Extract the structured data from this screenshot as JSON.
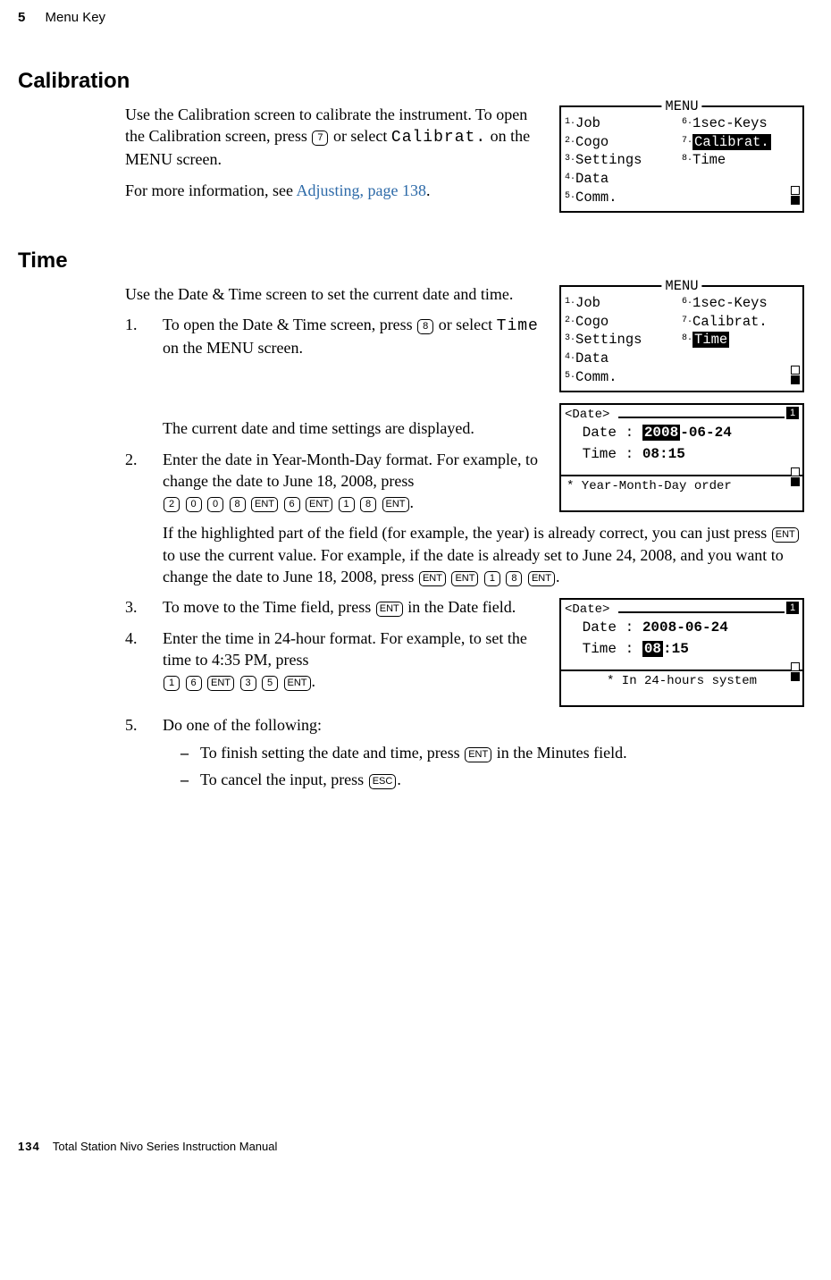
{
  "header": {
    "chapter": "5",
    "title": "Menu Key"
  },
  "calibration": {
    "heading": "Calibration",
    "p1a": "Use the Calibration screen to calibrate the instrument. To open the Calibration screen, press ",
    "p1_key": "7",
    "p1b": " or select ",
    "p1_mono": "Calibrat.",
    "p1c": " on the MENU screen.",
    "p2a": "For more information, see ",
    "p2_link": "Adjusting, page 138",
    "p2b": "."
  },
  "time": {
    "heading": "Time",
    "p1": "Use the Date & Time screen to set the current date and time.",
    "s1a": "To open the Date & Time screen, press ",
    "s1_key": "8",
    "s1b": " or select ",
    "s1_mono": "Time",
    "s1c": " on the MENU screen.",
    "s1d": "The current date and time settings are displayed.",
    "s2a": "Enter the date in Year-Month-Day format. For example, to change the date to June 18, 2008, press",
    "s2_keys": [
      "2",
      "0",
      "0",
      "8",
      "ENT",
      "6",
      "ENT",
      "1",
      "8",
      "ENT"
    ],
    "s2b": ".",
    "s2c_a": "If the highlighted part of the field (for example, the year) is already correct, you can just press ",
    "s2c_key": "ENT",
    "s2c_b": " to use the current value. For example, if the date is already set to June 24, 2008, and you want to change the date to June 18, 2008, press ",
    "s2c_keys": [
      "ENT",
      "ENT",
      "1",
      "8",
      "ENT"
    ],
    "s2c_c": ".",
    "s3a": "To move to the Time field, press ",
    "s3_key": "ENT",
    "s3b": " in the Date field.",
    "s4a": "Enter the time in 24-hour format. For example, to set the time to 4:35 PM, press",
    "s4_keys": [
      "1",
      "6",
      "ENT",
      "3",
      "5",
      "ENT"
    ],
    "s4b": ".",
    "s5": "Do one of the following:",
    "s5a_a": "To finish setting the date and time, press ",
    "s5a_key": "ENT",
    "s5a_b": " in the Minutes field.",
    "s5b_a": "To cancel the input, press ",
    "s5b_key": "ESC",
    "s5b_b": "."
  },
  "menu_screen": {
    "title": "MENU",
    "left": [
      "Job",
      "Cogo",
      "Settings",
      "Data",
      "Comm."
    ],
    "right": [
      "1sec-Keys",
      "Calibrat.",
      "Time"
    ]
  },
  "date_screen1": {
    "title": "<Date>",
    "corner": "1",
    "date_label": "Date",
    "date_val_hl": "2008",
    "date_val_rest": "-06-24",
    "time_label": "Time",
    "time_val": "08:15",
    "foot": "* Year-Month-Day order"
  },
  "date_screen2": {
    "title": "<Date>",
    "corner": "1",
    "date_label": "Date",
    "date_val": "2008-06-24",
    "time_label": "Time",
    "time_val_hl": "08",
    "time_val_rest": ":15",
    "foot": "* In 24-hours system"
  },
  "footer": {
    "page": "134",
    "book": "Total Station Nivo Series Instruction Manual"
  }
}
